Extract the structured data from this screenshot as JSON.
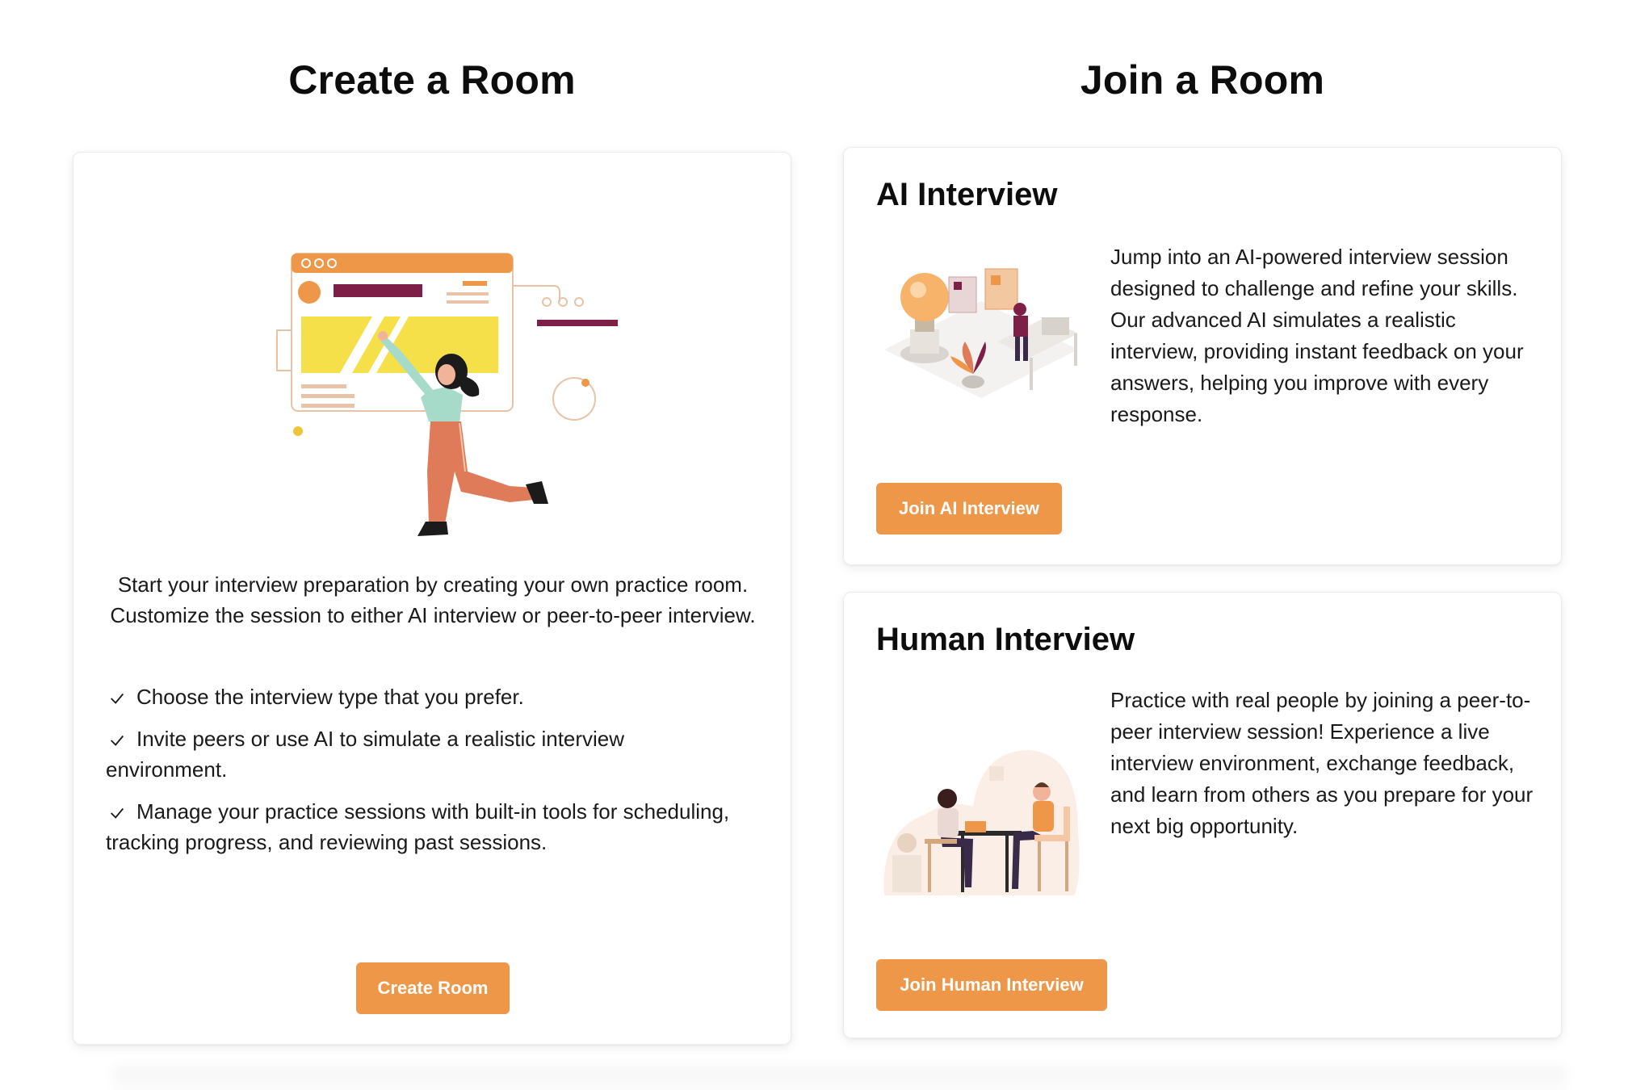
{
  "create": {
    "title": "Create a Room",
    "description": "Start your interview preparation by creating your own practice room. Customize the session to either AI interview or peer-to-peer interview.",
    "checklist": [
      "Choose the interview type that you prefer.",
      "Invite peers or use AI to simulate a realistic interview environment.",
      "Manage your practice sessions with built-in tools for scheduling, tracking progress, and reviewing past sessions."
    ],
    "button_label": "Create Room"
  },
  "join": {
    "title": "Join a Room",
    "ai": {
      "heading": "AI Interview",
      "description": "Jump into an AI-powered interview session designed to challenge and refine your skills. Our advanced AI simulates a realistic interview, providing instant feedback on your answers, helping you improve with every response.",
      "button_label": "Join AI Interview"
    },
    "human": {
      "heading": "Human Interview",
      "description": "Practice with real people by joining a peer-to-peer interview session! Experience a live interview environment, exchange feedback, and learn from others as you prepare for your next big opportunity.",
      "button_label": "Join Human Interview"
    }
  },
  "colors": {
    "accent": "#ef9749",
    "maroon": "#7e1f47",
    "yellow": "#f5e04a",
    "teal": "#a7dbc9",
    "skin": "#e07b5a"
  }
}
